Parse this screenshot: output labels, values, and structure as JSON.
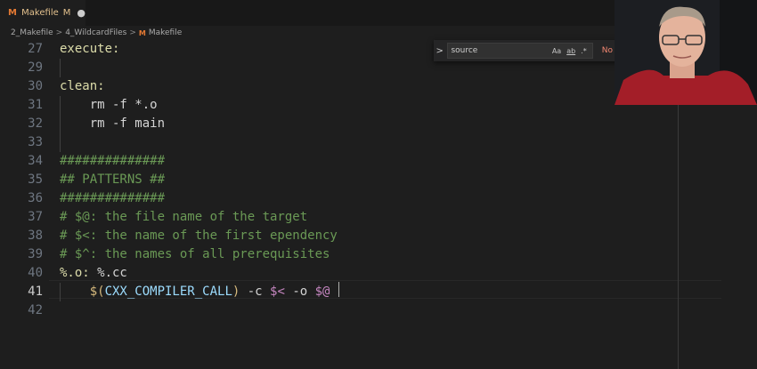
{
  "tab": {
    "icon": "makefile-icon",
    "letter": "M",
    "name": "Makefile",
    "status": "M",
    "dirty": "●"
  },
  "breadcrumb": {
    "parts": [
      "2_Makefile",
      "4_WildcardFiles",
      "Makefile"
    ],
    "separator": ">"
  },
  "find": {
    "query": "source",
    "case_label": "Aa",
    "word_label": "ab",
    "regex_label": ".*",
    "result": "No results"
  },
  "editor": {
    "lines": [
      {
        "number": "27",
        "text": "execute:"
      },
      {
        "number": "29",
        "text": ""
      },
      {
        "number": "30",
        "text": "clean:"
      },
      {
        "number": "31",
        "text": "    rm -f *.o"
      },
      {
        "number": "32",
        "text": "    rm -f main"
      },
      {
        "number": "33",
        "text": ""
      },
      {
        "number": "34",
        "text": "##############"
      },
      {
        "number": "35",
        "text": "## PATTERNS ##"
      },
      {
        "number": "36",
        "text": "##############"
      },
      {
        "number": "37",
        "text": "# $@: the file name of the target"
      },
      {
        "number": "38",
        "text": "# $<: the name of the first ependency"
      },
      {
        "number": "39",
        "text": "# $^: the names of all prerequisites"
      },
      {
        "number": "40",
        "text": "%.o: %.cc"
      },
      {
        "number": "41",
        "text": "    $(CXX_COMPILER_CALL) -c $< -o $@"
      },
      {
        "number": "42",
        "text": ""
      }
    ],
    "line41": {
      "indent": "    ",
      "open": "$(",
      "var": "CXX_COMPILER_CALL",
      "close": ")",
      "mid": " -c ",
      "auto1": "$<",
      "mid2": " -o ",
      "auto2": "$@"
    },
    "line40": {
      "target": "%.o:",
      "rest": " %.cc"
    },
    "active_line": "41"
  },
  "colors": {
    "accent_modified": "#e2c08d",
    "comment": "#6a9955",
    "no_results": "#f48771",
    "makefile_icon": "#e37933"
  }
}
